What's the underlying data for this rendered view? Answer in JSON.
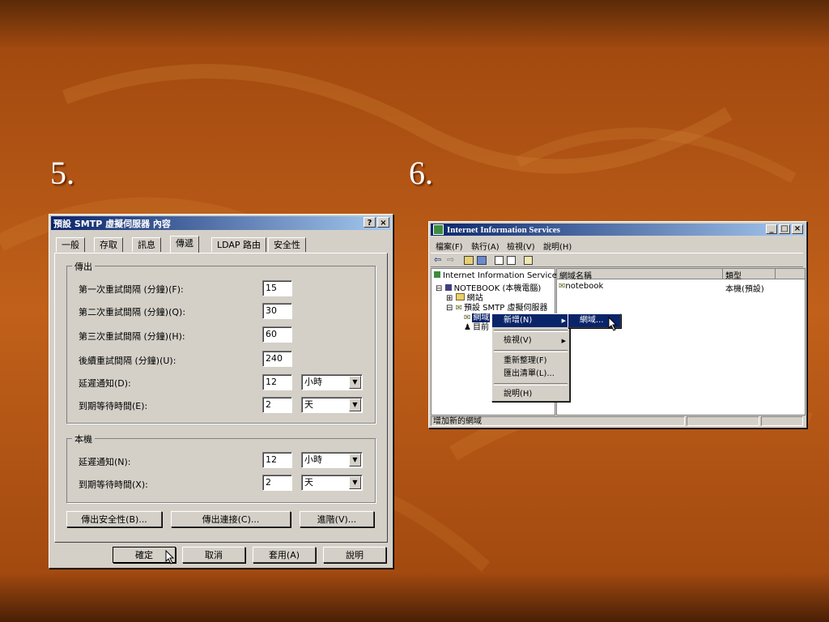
{
  "slide": {
    "left_number": "5.",
    "right_number": "6."
  },
  "dialog": {
    "title": "預設 SMTP 虛擬伺服器 內容",
    "help_btn": "?",
    "close_btn": "×",
    "tabs": [
      "一般",
      "存取",
      "訊息",
      "傳遞",
      "LDAP 路由",
      "安全性"
    ],
    "active_tab": "傳遞",
    "outbound": {
      "title": "傳出",
      "first_retry_label": "第一次重試間隔 (分鐘)(F):",
      "first_retry": "15",
      "second_retry_label": "第二次重試間隔 (分鐘)(Q):",
      "second_retry": "30",
      "third_retry_label": "第三次重試間隔 (分鐘)(H):",
      "third_retry": "60",
      "subsequent_retry_label": "後續重試間隔 (分鐘)(U):",
      "subsequent_retry": "240",
      "delay_label": "延遲通知(D):",
      "delay_value": "12",
      "delay_unit": "小時",
      "expire_label": "到期等待時間(E):",
      "expire_value": "2",
      "expire_unit": "天"
    },
    "local": {
      "title": "本機",
      "delay_label": "延遲通知(N):",
      "delay_value": "12",
      "delay_unit": "小時",
      "expire_label": "到期等待時間(X):",
      "expire_value": "2",
      "expire_unit": "天"
    },
    "outbound_security": "傳出安全性(B)...",
    "outbound_connections": "傳出連接(C)...",
    "advanced": "進階(V)...",
    "ok": "確定",
    "cancel": "取消",
    "apply": "套用(A)",
    "help": "說明"
  },
  "iis": {
    "title": "Internet Information Services",
    "menu": [
      "檔案(F)",
      "執行(A)",
      "檢視(V)",
      "說明(H)"
    ],
    "tree": {
      "root": "Internet Information Services",
      "computer": "NOTEBOOK (本機電腦)",
      "websites": "網站",
      "smtp": "預設 SMTP 虛擬伺服器",
      "domains": "網域",
      "current": "目前"
    },
    "columns": {
      "domain_name": "網域名稱",
      "type": "類型"
    },
    "rows": [
      {
        "name": "notebook",
        "type": "本機(預設)"
      }
    ],
    "context_menu": [
      "新增(N)",
      "檢視(V)",
      "重新整理(F)",
      "匯出清單(L)...",
      "說明(H)"
    ],
    "submenu": [
      "網域..."
    ],
    "status": "增加新的網域"
  },
  "colors": {
    "titlebar": "#0a246a",
    "face": "#d4d0c8",
    "highlight": "#0a246a"
  }
}
